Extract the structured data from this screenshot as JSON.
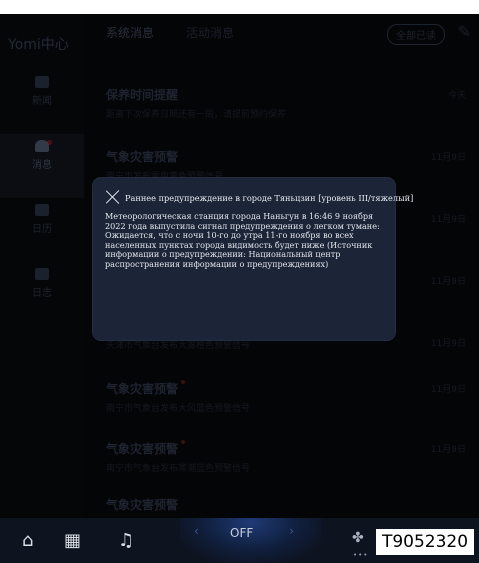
{
  "sidebar": {
    "brand": "Yomi中心",
    "items": [
      {
        "label": "新闻",
        "icon": "news-icon"
      },
      {
        "label": "消息",
        "icon": "bell-icon",
        "active": true
      },
      {
        "label": "日历",
        "icon": "calendar-icon"
      },
      {
        "label": "日志",
        "icon": "log-icon"
      }
    ]
  },
  "header": {
    "tabs": [
      "系统消息",
      "活动消息"
    ],
    "read_all_label": "全部已读",
    "edit_icon": "edit-icon"
  },
  "messages": [
    {
      "title": "保养时间提醒",
      "subtitle": "距离下次保养日期还有一周，请提前预约保养",
      "time": "今天"
    },
    {
      "title": "气象灾害预警",
      "subtitle": "南宁市发布雷电黄色预警信号",
      "time": "11月9日"
    },
    {
      "title": "",
      "subtitle": "",
      "time": "11月9日"
    },
    {
      "title": "",
      "subtitle": "",
      "time": "11月9日"
    },
    {
      "title": "",
      "subtitle": "天津市气象台发布大雾橙色预警信号",
      "time": "11月9日"
    },
    {
      "title": "气象灾害预警",
      "subtitle": "南宁市气象台发布大风蓝色预警信号",
      "time": "11月9日"
    },
    {
      "title": "气象灾害预警",
      "subtitle": "南宁市气象台发布寒潮蓝色预警信号",
      "time": "11月9日"
    },
    {
      "title": "气象灾害预警",
      "subtitle": "",
      "time": ""
    }
  ],
  "modal": {
    "title": "Раннее предупреждение в городе Тяньцзин [уровень III/тяжелый]",
    "body": "Метеорологическая станция города Наньгун в 16:46 9 ноября 2022 года выпустила сигнал предупреждения о легком тумане: Ожидается, что с ночи 10-го до утра 11-го ноября во всех населенных пунктах города видимость будет ниже (Источник информации о предупреждении: Национальный центр распространения информации о предупреждениях)"
  },
  "dock": {
    "climate_status": "OFF",
    "left_arrow": "‹",
    "right_arrow": "›",
    "id_label": "T9052320"
  }
}
